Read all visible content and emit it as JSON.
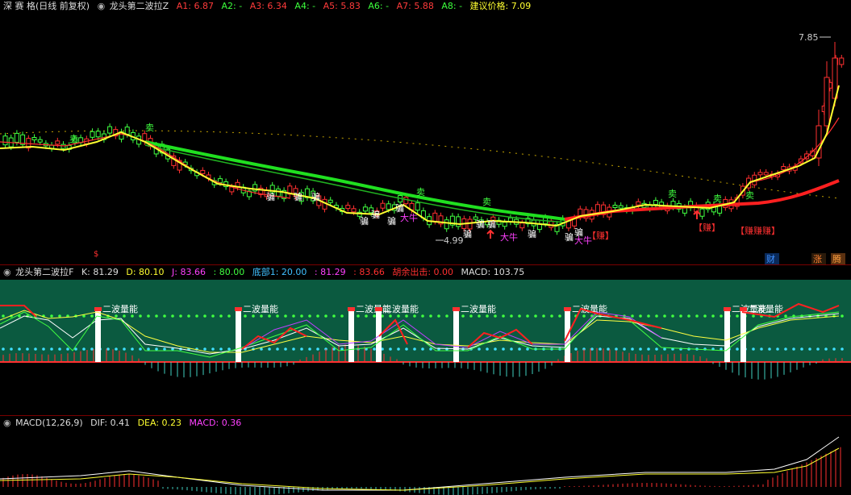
{
  "main": {
    "stock": "深 赛 格(日线 前复权)",
    "chevron": "◉",
    "indicator": "龙头第二波拉Z",
    "items": [
      {
        "label": "A1:",
        "value": "6.87",
        "color": "#ff3b3b"
      },
      {
        "label": "A2:",
        "value": "-",
        "color": "#3cff3c"
      },
      {
        "label": "A3:",
        "value": "6.34",
        "color": "#ff3b3b"
      },
      {
        "label": "A4:",
        "value": "-",
        "color": "#3cff3c"
      },
      {
        "label": "A5:",
        "value": "5.83",
        "color": "#ff3b3b"
      },
      {
        "label": "A6:",
        "value": "-",
        "color": "#3cff3c"
      },
      {
        "label": "A7:",
        "value": "5.88",
        "color": "#ff3b3b"
      },
      {
        "label": "A8:",
        "value": "-",
        "color": "#3cff3c"
      }
    ],
    "advice_label": "建议价格:",
    "advice_value": "7.09",
    "high_price": "7.85",
    "low_price": "4.99",
    "sell_label": "卖",
    "cheat_label": "骗",
    "bull_label": "大牛",
    "earn_label": "【赚】",
    "earn_double": "【赚赚赚】",
    "marker_cai": "财",
    "marker_zhang": "涨",
    "marker_teng": "腾",
    "dollar_marker": "$"
  },
  "kdj": {
    "chevron": "◉",
    "name": "龙头第二波拉F",
    "k_label": "K:",
    "k": "81.29",
    "d_label": "D:",
    "d": "80.10",
    "j_label": "J:",
    "j": "83.66",
    "val4": ": 80.00",
    "bottom_label": "底部1:",
    "bottom": "20.00",
    "v6": ": 81.29",
    "v7": ": 83.66",
    "exit_label": "胡余出击:",
    "exit": "0.00",
    "macd_label": "MACD:",
    "macd": "103.75",
    "wave_label": "二波量能"
  },
  "macd": {
    "chevron": "◉",
    "name": "MACD(12,26,9)",
    "dif_label": "DIF:",
    "dif": "0.41",
    "dea_label": "DEA:",
    "dea": "0.23",
    "macd_label": "MACD:",
    "macd": "0.36"
  },
  "colors": {
    "up": "#ff3030",
    "down": "#40ff40",
    "ma_yellow": "#ffff30",
    "ma_green": "#20e020",
    "kdj_bg": "#0b5a40",
    "magenta": "#ff40ff"
  }
}
